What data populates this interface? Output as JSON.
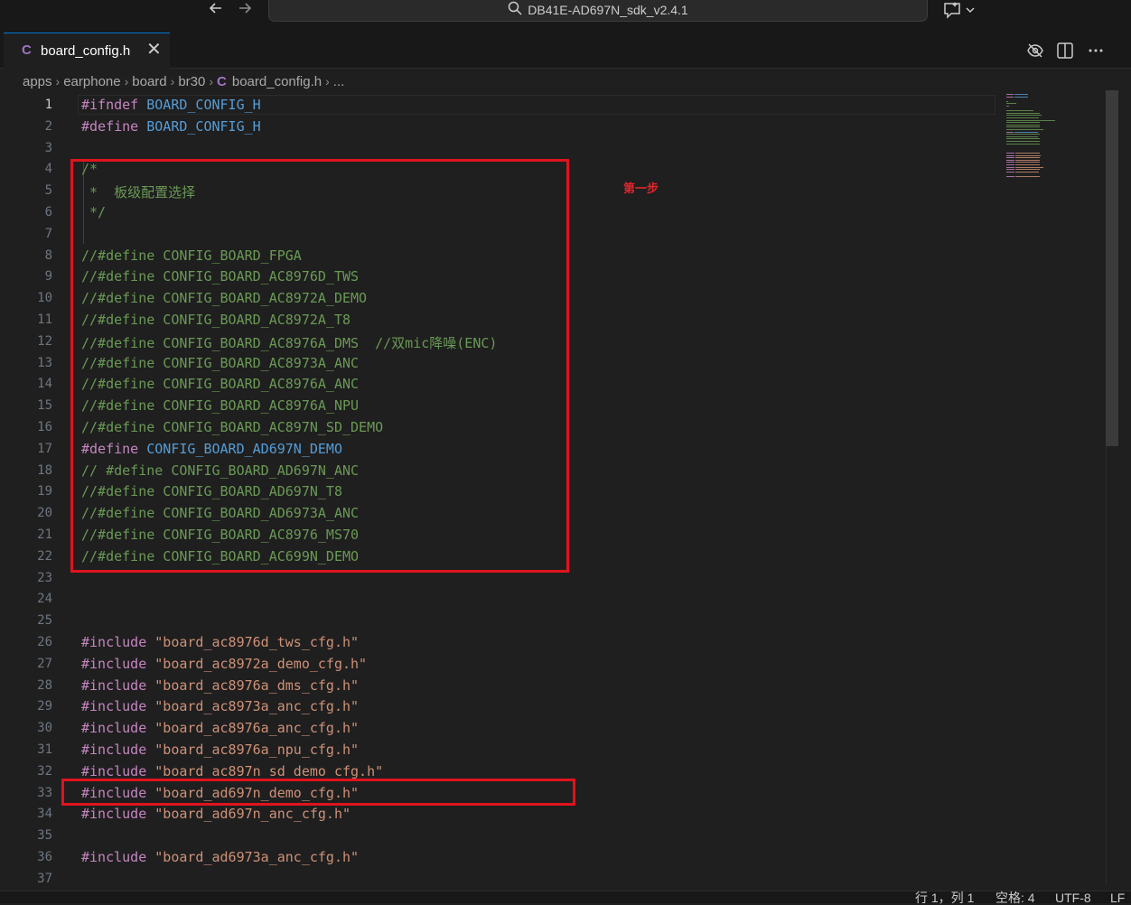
{
  "title_bar": {
    "search_text": "DB41E-AD697N_sdk_v2.4.1",
    "back_icon": "arrow-left-icon",
    "forward_icon": "arrow-right-icon",
    "copilot_icon": "copilot-chat-icon"
  },
  "tab": {
    "file_icon": "C",
    "label": "board_config.h",
    "close": "✕"
  },
  "editor_actions": [
    "hide-whitespace-icon",
    "split-editor-icon",
    "more-actions-icon"
  ],
  "breadcrumb": {
    "items": [
      "apps",
      "earphone",
      "board",
      "br30"
    ],
    "file_icon": "C",
    "file": "board_config.h",
    "more": "..."
  },
  "code_lines": [
    {
      "n": "1",
      "tokens": [
        {
          "c": "kw",
          "t": "#ifndef"
        },
        {
          "c": "",
          "t": " "
        },
        {
          "c": "mac",
          "t": "BOARD_CONFIG_H"
        }
      ]
    },
    {
      "n": "2",
      "tokens": [
        {
          "c": "kw",
          "t": "#define"
        },
        {
          "c": "",
          "t": " "
        },
        {
          "c": "mac",
          "t": "BOARD_CONFIG_H"
        }
      ]
    },
    {
      "n": "3",
      "tokens": []
    },
    {
      "n": "4",
      "tokens": [
        {
          "c": "com",
          "t": "/*"
        }
      ]
    },
    {
      "n": "5",
      "tokens": [
        {
          "c": "com",
          "t": " *  板级配置选择"
        }
      ]
    },
    {
      "n": "6",
      "tokens": [
        {
          "c": "com",
          "t": " */"
        }
      ]
    },
    {
      "n": "7",
      "tokens": []
    },
    {
      "n": "8",
      "tokens": [
        {
          "c": "com",
          "t": "//#define CONFIG_BOARD_FPGA"
        }
      ]
    },
    {
      "n": "9",
      "tokens": [
        {
          "c": "com",
          "t": "//#define CONFIG_BOARD_AC8976D_TWS"
        }
      ]
    },
    {
      "n": "10",
      "tokens": [
        {
          "c": "com",
          "t": "//#define CONFIG_BOARD_AC8972A_DEMO"
        }
      ]
    },
    {
      "n": "11",
      "tokens": [
        {
          "c": "com",
          "t": "//#define CONFIG_BOARD_AC8972A_T8"
        }
      ]
    },
    {
      "n": "12",
      "tokens": [
        {
          "c": "com",
          "t": "//#define CONFIG_BOARD_AC8976A_DMS  //双mic降噪(ENC)"
        }
      ]
    },
    {
      "n": "13",
      "tokens": [
        {
          "c": "com",
          "t": "//#define CONFIG_BOARD_AC8973A_ANC"
        }
      ]
    },
    {
      "n": "14",
      "tokens": [
        {
          "c": "com",
          "t": "//#define CONFIG_BOARD_AC8976A_ANC"
        }
      ]
    },
    {
      "n": "15",
      "tokens": [
        {
          "c": "com",
          "t": "//#define CONFIG_BOARD_AC8976A_NPU"
        }
      ]
    },
    {
      "n": "16",
      "tokens": [
        {
          "c": "com",
          "t": "//#define CONFIG_BOARD_AC897N_SD_DEMO"
        }
      ]
    },
    {
      "n": "17",
      "tokens": [
        {
          "c": "kw",
          "t": "#define"
        },
        {
          "c": "",
          "t": " "
        },
        {
          "c": "mac",
          "t": "CONFIG_BOARD_AD697N_DEMO"
        }
      ]
    },
    {
      "n": "18",
      "tokens": [
        {
          "c": "com",
          "t": "// #define CONFIG_BOARD_AD697N_ANC"
        }
      ]
    },
    {
      "n": "19",
      "tokens": [
        {
          "c": "com",
          "t": "//#define CONFIG_BOARD_AD697N_T8"
        }
      ]
    },
    {
      "n": "20",
      "tokens": [
        {
          "c": "com",
          "t": "//#define CONFIG_BOARD_AD6973A_ANC"
        }
      ]
    },
    {
      "n": "21",
      "tokens": [
        {
          "c": "com",
          "t": "//#define CONFIG_BOARD_AC8976_MS70"
        }
      ]
    },
    {
      "n": "22",
      "tokens": [
        {
          "c": "com",
          "t": "//#define CONFIG_BOARD_AC699N_DEMO"
        }
      ]
    },
    {
      "n": "23",
      "tokens": []
    },
    {
      "n": "24",
      "tokens": []
    },
    {
      "n": "25",
      "tokens": []
    },
    {
      "n": "26",
      "tokens": [
        {
          "c": "kw",
          "t": "#include"
        },
        {
          "c": "",
          "t": " "
        },
        {
          "c": "str",
          "t": "\"board_ac8976d_tws_cfg.h\""
        }
      ]
    },
    {
      "n": "27",
      "tokens": [
        {
          "c": "kw",
          "t": "#include"
        },
        {
          "c": "",
          "t": " "
        },
        {
          "c": "str",
          "t": "\"board_ac8972a_demo_cfg.h\""
        }
      ]
    },
    {
      "n": "28",
      "tokens": [
        {
          "c": "kw",
          "t": "#include"
        },
        {
          "c": "",
          "t": " "
        },
        {
          "c": "str",
          "t": "\"board_ac8976a_dms_cfg.h\""
        }
      ]
    },
    {
      "n": "29",
      "tokens": [
        {
          "c": "kw",
          "t": "#include"
        },
        {
          "c": "",
          "t": " "
        },
        {
          "c": "str",
          "t": "\"board_ac8973a_anc_cfg.h\""
        }
      ]
    },
    {
      "n": "30",
      "tokens": [
        {
          "c": "kw",
          "t": "#include"
        },
        {
          "c": "",
          "t": " "
        },
        {
          "c": "str",
          "t": "\"board_ac8976a_anc_cfg.h\""
        }
      ]
    },
    {
      "n": "31",
      "tokens": [
        {
          "c": "kw",
          "t": "#include"
        },
        {
          "c": "",
          "t": " "
        },
        {
          "c": "str",
          "t": "\"board_ac8976a_npu_cfg.h\""
        }
      ]
    },
    {
      "n": "32",
      "tokens": [
        {
          "c": "kw",
          "t": "#include"
        },
        {
          "c": "",
          "t": " "
        },
        {
          "c": "str",
          "t": "\"board_ac897n_sd_demo_cfg.h\""
        }
      ]
    },
    {
      "n": "33",
      "tokens": [
        {
          "c": "kw",
          "t": "#include"
        },
        {
          "c": "",
          "t": " "
        },
        {
          "c": "str",
          "t": "\"board_ad697n_demo_cfg.h\""
        }
      ]
    },
    {
      "n": "34",
      "tokens": [
        {
          "c": "kw",
          "t": "#include"
        },
        {
          "c": "",
          "t": " "
        },
        {
          "c": "str",
          "t": "\"board_ad697n_anc_cfg.h\""
        }
      ]
    },
    {
      "n": "35",
      "tokens": []
    },
    {
      "n": "36",
      "tokens": [
        {
          "c": "kw",
          "t": "#include"
        },
        {
          "c": "",
          "t": " "
        },
        {
          "c": "str",
          "t": "\"board_ad6973a_anc_cfg.h\""
        }
      ]
    },
    {
      "n": "37",
      "tokens": []
    }
  ],
  "annotation": {
    "note": "第一步",
    "box_color": "#e0131e"
  },
  "status_bar": {
    "position": "行 1，列 1",
    "indent": "空格: 4",
    "encoding": "UTF-8",
    "eol": "LF"
  },
  "colors": {
    "keyword": "#c586c0",
    "macro": "#569cd6",
    "comment": "#6a9955",
    "string": "#ce9178",
    "accent": "#0078d4"
  }
}
